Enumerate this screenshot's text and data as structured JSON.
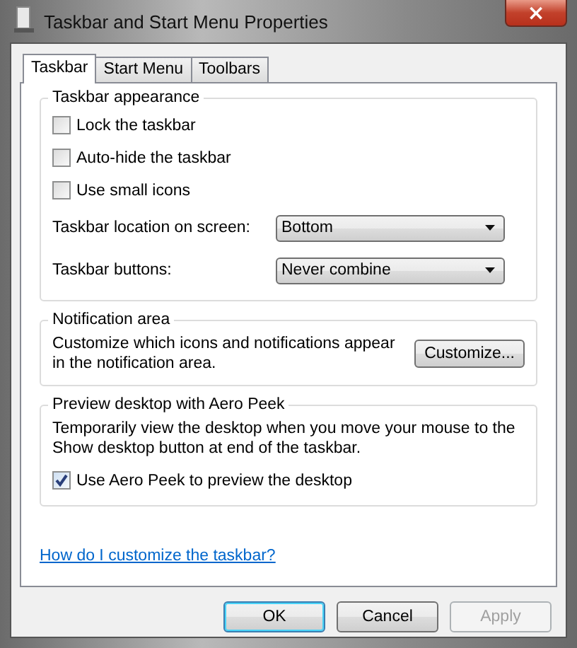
{
  "window": {
    "title": "Taskbar and Start Menu Properties",
    "close": "×"
  },
  "tabs": [
    {
      "label": "Taskbar",
      "selected": true
    },
    {
      "label": "Start Menu",
      "selected": false
    },
    {
      "label": "Toolbars",
      "selected": false
    }
  ],
  "groups": [
    {
      "title": "Taskbar appearance",
      "items": [
        {
          "kind": "checkbox",
          "label": "Lock the taskbar",
          "checked": false
        },
        {
          "kind": "checkbox",
          "label": "Auto-hide the taskbar",
          "checked": false
        },
        {
          "kind": "checkbox",
          "label": "Use small icons",
          "checked": false
        },
        {
          "kind": "dropdown",
          "label": "Taskbar location on screen:",
          "value": "Bottom"
        },
        {
          "kind": "dropdown",
          "label": "Taskbar buttons:",
          "value": "Never combine"
        }
      ]
    },
    {
      "title": "Notification area",
      "items": [
        {
          "kind": "textbutton",
          "text": "Customize which icons and notifications appear in the notification area.",
          "button": "Customize..."
        }
      ]
    },
    {
      "title": "Preview desktop with Aero Peek",
      "items": [
        {
          "kind": "text",
          "text": "Temporarily view the desktop when you move your mouse to the Show desktop button at end of the taskbar."
        },
        {
          "kind": "checkbox",
          "label": "Use Aero Peek to preview the desktop",
          "checked": true
        }
      ]
    }
  ],
  "help_link": "How do I customize the taskbar?",
  "buttons": [
    {
      "label": "OK",
      "default": true,
      "disabled": false
    },
    {
      "label": "Cancel",
      "default": false,
      "disabled": false
    },
    {
      "label": "Apply",
      "default": false,
      "disabled": true
    }
  ]
}
